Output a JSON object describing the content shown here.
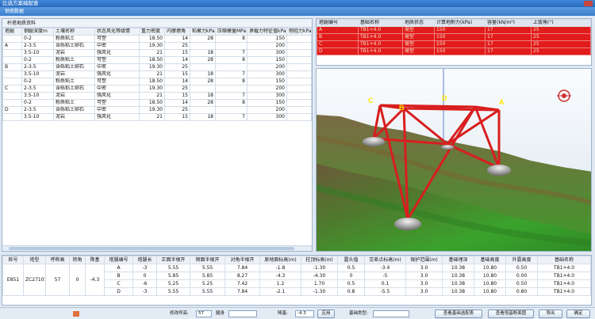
{
  "window": {
    "title": "比选方案编配查"
  },
  "toolbar": {
    "label": "钢塔数据"
  },
  "left_panel": {
    "header": "杆塔地质资料",
    "columns": [
      "塔腿",
      "钢腿深度m",
      "土壤名称",
      "状态风化等级情",
      "重力密度",
      "内摩擦角",
      "粘聚力kPa",
      "压缩模量MPa",
      "承载力特征值kPa",
      "侧阻力kPa"
    ],
    "rows": [
      [
        "",
        "0-2",
        "粉质粘土",
        "可塑",
        "18.50",
        "14",
        "28",
        "8",
        "150",
        ""
      ],
      [
        "A",
        "2-3.5",
        "含砾粘土卵石",
        "中密",
        "19.30",
        "25",
        "",
        "",
        "200",
        ""
      ],
      [
        "",
        "3.5-10",
        "泥岩",
        "强风化",
        "21",
        "15",
        "18",
        "7",
        "300",
        ""
      ],
      [
        "",
        "0-2",
        "粉质粘土",
        "可塑",
        "18.50",
        "14",
        "28",
        "8",
        "150",
        ""
      ],
      [
        "B",
        "2-3.5",
        "含砾粘土卵石",
        "中密",
        "19.30",
        "25",
        "",
        "",
        "200",
        ""
      ],
      [
        "",
        "3.5-10",
        "泥岩",
        "强风化",
        "21",
        "15",
        "18",
        "7",
        "300",
        ""
      ],
      [
        "",
        "0-2",
        "粉质粘土",
        "可塑",
        "18.50",
        "14",
        "28",
        "8",
        "150",
        ""
      ],
      [
        "C",
        "2-3.5",
        "含砾粘土卵石",
        "中密",
        "19.30",
        "25",
        "",
        "",
        "200",
        ""
      ],
      [
        "",
        "3.5-10",
        "泥岩",
        "强风化",
        "21",
        "15",
        "18",
        "7",
        "300",
        ""
      ],
      [
        "",
        "0-2",
        "粉质粘土",
        "可塑",
        "18.50",
        "14",
        "28",
        "8",
        "150",
        ""
      ],
      [
        "D",
        "2-3.5",
        "含砾粘土卵石",
        "中密",
        "19.30",
        "25",
        "",
        "",
        "200",
        ""
      ],
      [
        "",
        "3.5-10",
        "泥岩",
        "强风化",
        "21",
        "15",
        "18",
        "7",
        "300",
        ""
      ]
    ]
  },
  "foundation_panel": {
    "columns": [
      "塔腿编号",
      "基础名称",
      "地质状态",
      "计算地耐力(kPa)",
      "容量(kN/m³)",
      "上拔角(°)"
    ],
    "rows": [
      [
        "A",
        "TB1+4.0",
        "坡型",
        "150",
        "17",
        "25"
      ],
      [
        "B",
        "TB1+4.0",
        "坡型",
        "150",
        "17",
        "25"
      ],
      [
        "C",
        "TB1+4.0",
        "坡型",
        "150",
        "17",
        "25"
      ],
      [
        "D",
        "TB1+4.0",
        "坡型",
        "150",
        "17",
        "25"
      ]
    ]
  },
  "view3d": {
    "labels": [
      "C",
      "B",
      "D",
      "A"
    ]
  },
  "bottom_panel": {
    "columns": [
      "桩号",
      "塔型",
      "呼称高",
      "转角",
      "降基",
      "塔腿编号",
      "塔腿长",
      "正面半根开",
      "侧面半根开",
      "对角半根开",
      "原地面标高(m)",
      "柱顶标高(m)",
      "露头值",
      "交差点标高(m)",
      "保护范围(m)",
      "基础埋深",
      "基础高度",
      "外露高度",
      "基础名称"
    ],
    "tower": {
      "id": "E851",
      "type": "ZC27101",
      "height": "57",
      "angle": "0",
      "lower": "-4.3"
    },
    "rows": [
      [
        "A",
        "-3",
        "5.55",
        "5.55",
        "7.84",
        "-1.8",
        "-1.30",
        "0.5",
        "-3.4",
        "3.0",
        "10.38",
        "10.80",
        "0.50",
        "TB1+4.0"
      ],
      [
        "B",
        "0",
        "5.85",
        "5.85",
        "8.27",
        "-4.3",
        "-4.30",
        "0",
        "-5",
        "3.0",
        "10.38",
        "10.80",
        "0.00",
        "TB1+4.0"
      ],
      [
        "C",
        "-6",
        "5.25",
        "5.25",
        "7.42",
        "1.2",
        "1.70",
        "0.5",
        "0.1",
        "3.0",
        "10.38",
        "10.80",
        "0.50",
        "TB1+4.0"
      ],
      [
        "D",
        "-3",
        "5.55",
        "5.55",
        "7.84",
        "-2.1",
        "-1.30",
        "0.8",
        "-5.5",
        "3.0",
        "10.38",
        "10.80",
        "0.80",
        "TB1+4.0"
      ]
    ]
  },
  "statusbar": {
    "height_label": "修改呼高:",
    "height_value": "57",
    "leg_label": "腿身",
    "lower_label": "降基:",
    "lower_value": "-4.3",
    "apply": "应用",
    "foundation_type_label": "基础类型:",
    "btn_view_foundation": "查看基础选配表",
    "btn_view_section": "查看塔基断面图",
    "btn_export": "导出",
    "btn_ok": "确定"
  },
  "colors": {
    "highlight_red": "#e21b1b",
    "title_blue": "#2a6cc0",
    "tower_red": "#d81e1e",
    "label_yellow": "#ffe600"
  }
}
